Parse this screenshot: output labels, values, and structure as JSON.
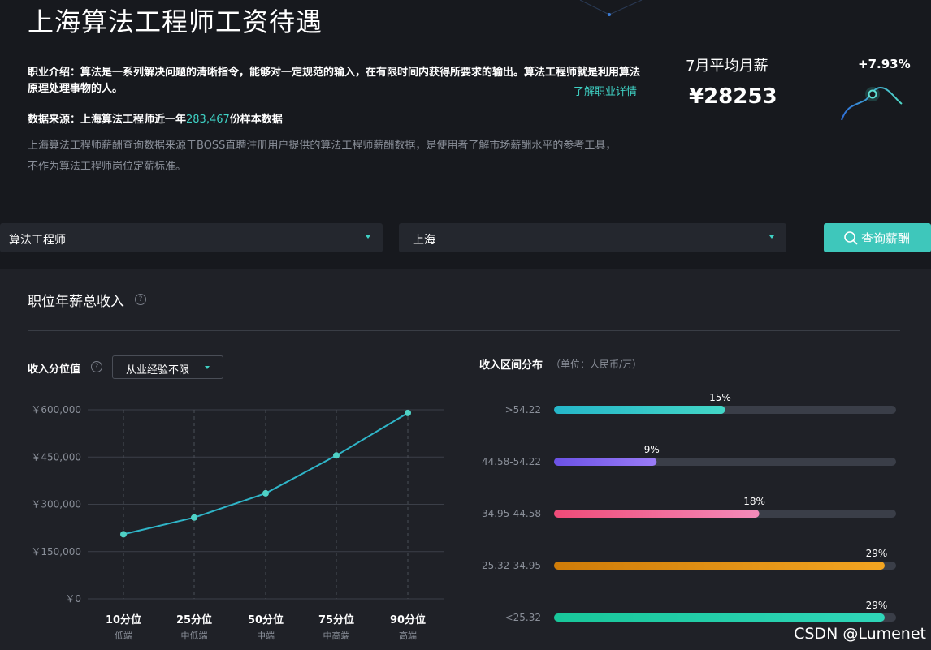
{
  "header": {
    "title": "上海算法工程师工资待遇",
    "intro": "职业介绍：算法是一系列解决问题的清晰指令，能够对一定规范的输入，在有限时间内获得所要求的输出。算法工程师就是利用算法原理处理事物的人。",
    "intro_link": "了解职业详情",
    "source_prefix": "数据来源：上海算法工程师近一年",
    "source_count": "283,467",
    "source_suffix": "份样本数据",
    "disclaimer": "上海算法工程师薪酬查询数据来源于BOSS直聘注册用户提供的算法工程师薪酬数据，是使用者了解市场薪酬水平的参考工具，不作为算法工程师岗位定薪标准。"
  },
  "stats": {
    "avg_label": "7月平均月薪",
    "avg_value": "¥28253",
    "change": "+7.93%"
  },
  "search": {
    "job_value": "算法工程师",
    "city_value": "上海",
    "button_label": "查询薪酬"
  },
  "section": {
    "title": "职位年薪总收入",
    "help_glyph": "?",
    "percentile_label": "收入分位值",
    "experience_value": "从业经验不限",
    "dist_title": "收入区间分布",
    "dist_unit": "（单位：人民币/万）"
  },
  "chart_data": [
    {
      "type": "line",
      "categories": [
        "10分位",
        "25分位",
        "50分位",
        "75分位",
        "90分位"
      ],
      "category_sublabels": [
        "低端",
        "中低端",
        "中端",
        "中高端",
        "高端"
      ],
      "values": [
        205000,
        258000,
        335000,
        455000,
        590000
      ],
      "yticks": [
        0,
        150000,
        300000,
        450000,
        600000
      ],
      "ytick_labels": [
        "￥0",
        "￥150,000",
        "￥300,000",
        "￥450,000",
        "￥600,000"
      ],
      "ylim": [
        0,
        600000
      ],
      "grid": true,
      "line_color": "#2fb5c8",
      "point_color": "#4fd1c5"
    },
    {
      "type": "bar",
      "orientation": "horizontal",
      "categories": [
        ">54.22",
        "44.58-54.22",
        "34.95-44.58",
        "25.32-34.95",
        "<25.32"
      ],
      "values": [
        15,
        9,
        18,
        29,
        29
      ],
      "value_labels": [
        "15%",
        "9%",
        "18%",
        "29%",
        "29%"
      ],
      "xlim": [
        0,
        30
      ],
      "colors": [
        [
          "#25b6c9",
          "#43d6c6"
        ],
        [
          "#6b52e6",
          "#9a7cf6"
        ],
        [
          "#ef4b78",
          "#f48bba"
        ],
        [
          "#cf7c08",
          "#f3a521"
        ],
        [
          "#18c79a",
          "#2fd6b9"
        ]
      ],
      "track_color": "#3a3e48"
    }
  ],
  "watermark": "CSDN @Lumenet"
}
